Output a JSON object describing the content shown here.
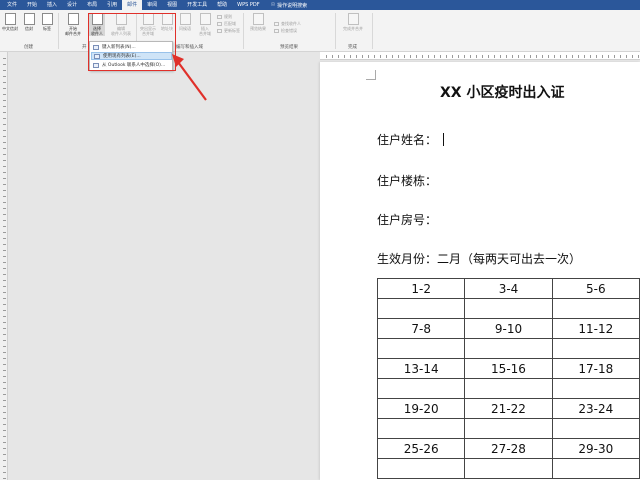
{
  "tabs": [
    "文件",
    "开始",
    "插入",
    "设计",
    "布局",
    "引用",
    "邮件",
    "审阅",
    "视图",
    "开发工具",
    "帮助",
    "WPS PDF"
  ],
  "active_tab_index": 6,
  "tell_me": "操作说明搜索",
  "ribbon": {
    "buttons": [
      {
        "label": "中文信封",
        "dim": false
      },
      {
        "label": "信封",
        "dim": false
      },
      {
        "label": "标签",
        "dim": false
      },
      {
        "label": "开始\n邮件合并",
        "dim": false
      },
      {
        "label": "选择\n收件人",
        "dim": false
      },
      {
        "label": "编辑\n收件人列表",
        "dim": true
      },
      {
        "label": "突出显示\n合并域",
        "dim": true
      },
      {
        "label": "地址块",
        "dim": true
      },
      {
        "label": "问候语",
        "dim": true
      },
      {
        "label": "插入\n合并域",
        "dim": true
      },
      {
        "label": "预览结果",
        "dim": true
      },
      {
        "label": "完成并合并",
        "dim": true
      }
    ],
    "small_items": [
      "规则",
      "匹配域",
      "更新标签",
      "查找收件人",
      "检查错误"
    ],
    "groups": [
      "创建",
      "开",
      "编写和插入域",
      "预览结果",
      "完成"
    ]
  },
  "dropdown": {
    "items": [
      {
        "label": "键入新列表(N)...",
        "hover": false
      },
      {
        "label": "使用现有列表(E)...",
        "hover": true
      },
      {
        "label": "从 Outlook 联系人中选择(O)...",
        "hover": false
      }
    ]
  },
  "document": {
    "title": "XX 小区疫时出入证",
    "fields": [
      "住户姓名：",
      "住户楼栋：",
      "住户房号：",
      "生效月份：二月（每两天可出去一次）"
    ],
    "table": [
      [
        "1-2",
        "3-4",
        "5-6"
      ],
      [
        "",
        "",
        ""
      ],
      [
        "7-8",
        "9-10",
        "11-12"
      ],
      [
        "",
        "",
        ""
      ],
      [
        "13-14",
        "15-16",
        "17-18"
      ],
      [
        "",
        "",
        ""
      ],
      [
        "19-20",
        "21-22",
        "23-24"
      ],
      [
        "",
        "",
        ""
      ],
      [
        "25-26",
        "27-28",
        "29-30"
      ],
      [
        "",
        "",
        ""
      ]
    ]
  },
  "colors": {
    "title_bar": "#2b579a",
    "highlight": "#e0302a",
    "hover": "#cfe4f7"
  }
}
